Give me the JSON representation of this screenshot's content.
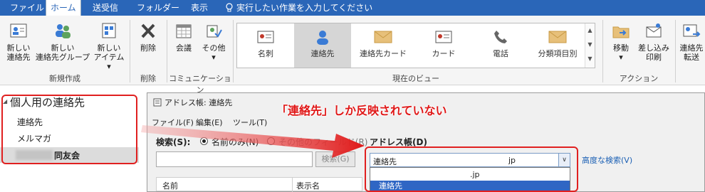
{
  "tabs": [
    {
      "label": "ファイル"
    },
    {
      "label": "ホーム"
    },
    {
      "label": "送受信"
    },
    {
      "label": "フォルダー"
    },
    {
      "label": "表示"
    }
  ],
  "tell_me": "実行したい作業を入力してください",
  "ribbon": {
    "new_contact": [
      "新しい",
      "連絡先"
    ],
    "new_group": [
      "新しい",
      "連絡先グループ"
    ],
    "new_items": [
      "新しい",
      "アイテム ▾"
    ],
    "group_new": "新規作成",
    "delete": "削除",
    "group_delete": "削除",
    "meeting": "会議",
    "more": [
      "その他",
      "▾"
    ],
    "group_comm": "コミュニケーション",
    "views": [
      "名刺",
      "連絡先",
      "連絡先カード",
      "カード",
      "電話",
      "分類項目別"
    ],
    "group_view": "現在のビュー",
    "move": [
      "移動",
      "▾"
    ],
    "mail_merge": [
      "差し込み",
      "印刷"
    ],
    "group_action": "アクション",
    "forward": [
      "連絡先",
      "転送"
    ]
  },
  "left_pane": {
    "header": "個人用の連絡先",
    "items": [
      "連絡先",
      "メルマガ",
      "同友会"
    ]
  },
  "dialog": {
    "title": "アドレス帳: 連絡先",
    "menu": [
      "ファイル(F)",
      "編集(E)",
      "ツール(T)"
    ],
    "search_label": "検索(S):",
    "radio_name_only": "名前のみ(N)",
    "radio_other_fields": "その他のフィールド(R)",
    "address_book_label": "アドレス帳(D)",
    "search_button": "検索(G)",
    "combo_value": "連絡先",
    "combo_suffix": "jp",
    "list_item_1": ".jp",
    "list_item_2": "連絡先",
    "advanced_search": "高度な検索(V)",
    "col_name": "名前",
    "col_display": "表示名"
  },
  "annotation": "「連絡先」しか反映されていない",
  "colors": {
    "accent": "#2a66b8",
    "highlight": "#e02020",
    "selection": "#2f66c4"
  }
}
